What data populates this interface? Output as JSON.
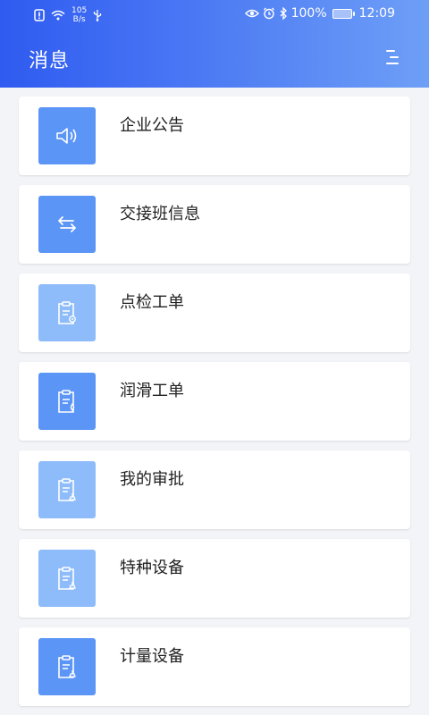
{
  "status": {
    "net_speed_top": "105",
    "net_speed_bottom": "B/s",
    "battery": "100%",
    "time": "12:09"
  },
  "header": {
    "title": "消息"
  },
  "items": [
    {
      "label": "企业公告",
      "icon": "speaker-icon",
      "tile_color": "#5b95f6"
    },
    {
      "label": "交接班信息",
      "icon": "exchange-arrows-icon",
      "tile_color": "#5b95f6"
    },
    {
      "label": "点检工单",
      "icon": "clipboard-icon",
      "tile_color": "#8ebcfa"
    },
    {
      "label": "润滑工单",
      "icon": "clipboard-icon",
      "tile_color": "#5b95f6"
    },
    {
      "label": "我的审批",
      "icon": "clipboard-icon",
      "tile_color": "#8ebcfa"
    },
    {
      "label": "特种设备",
      "icon": "clipboard-icon",
      "tile_color": "#8ebcfa"
    },
    {
      "label": "计量设备",
      "icon": "clipboard-icon",
      "tile_color": "#5b95f6"
    }
  ]
}
